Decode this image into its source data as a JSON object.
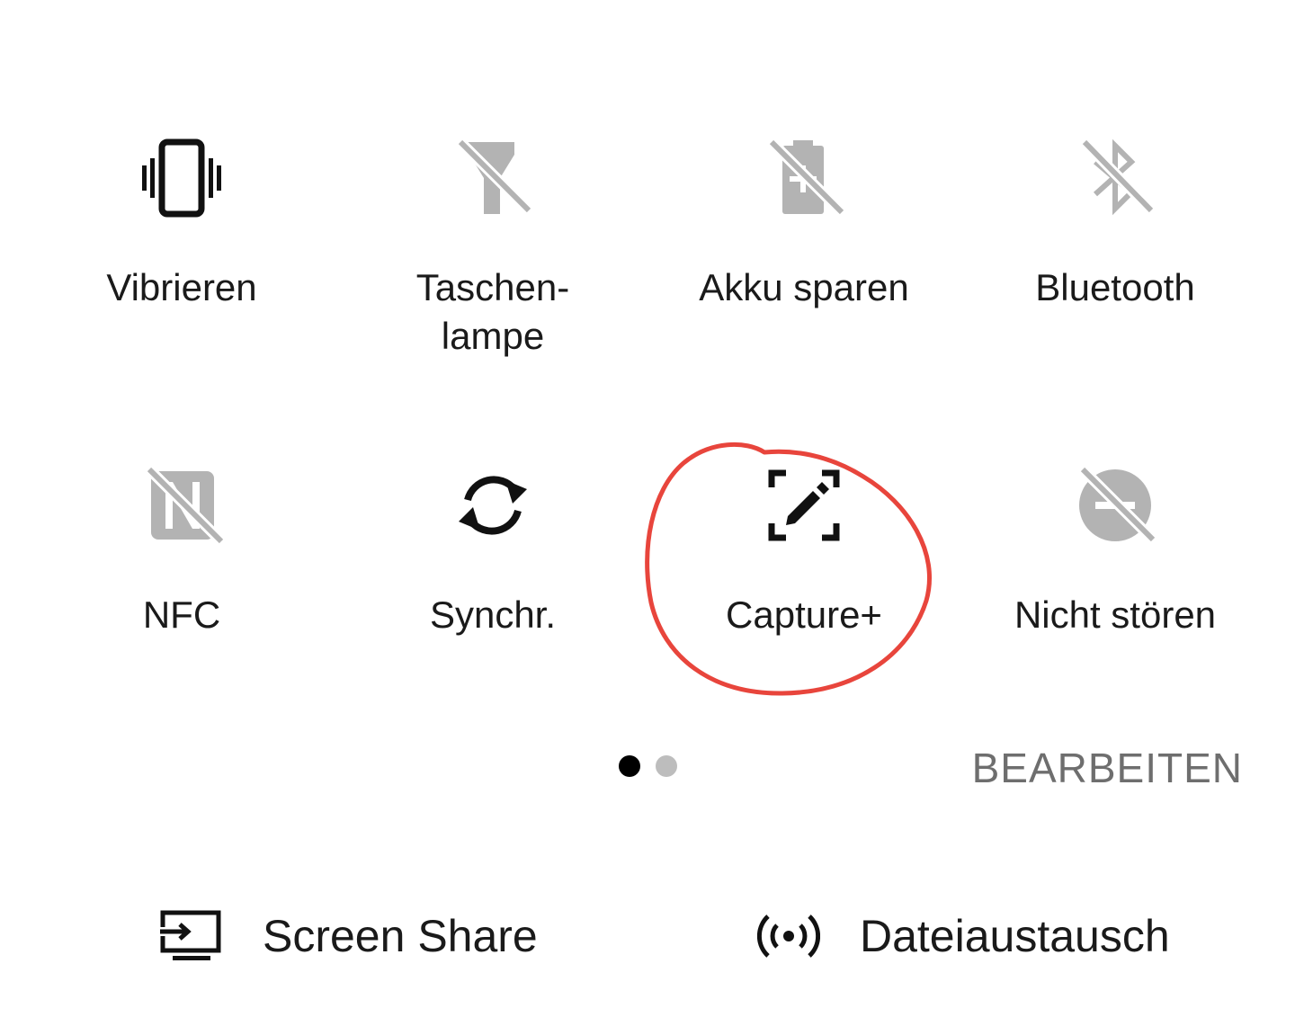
{
  "tiles": [
    {
      "label": "Vibrieren",
      "icon": "vibrate-icon",
      "state": "on"
    },
    {
      "label": "Taschen-\nlampe",
      "icon": "flashlight-off-icon",
      "state": "off"
    },
    {
      "label": "Akku sparen",
      "icon": "battery-saver-off-icon",
      "state": "off"
    },
    {
      "label": "Bluetooth",
      "icon": "bluetooth-off-icon",
      "state": "off"
    },
    {
      "label": "NFC",
      "icon": "nfc-off-icon",
      "state": "off"
    },
    {
      "label": "Synchr.",
      "icon": "sync-icon",
      "state": "on"
    },
    {
      "label": "Capture+",
      "icon": "capture-plus-icon",
      "state": "on"
    },
    {
      "label": "Nicht stören",
      "icon": "do-not-disturb-off-icon",
      "state": "off"
    }
  ],
  "pager": {
    "pages": 2,
    "current": 1
  },
  "edit_label": "BEARBEITEN",
  "shortcuts": [
    {
      "label": "Screen Share",
      "icon": "screen-share-icon"
    },
    {
      "label": "Dateiaustausch",
      "icon": "file-share-icon"
    }
  ],
  "colors": {
    "active": "#111111",
    "inactive": "#b3b3b3",
    "text": "#1a1a1a",
    "edit": "#6e6e6e",
    "annotation": "#e8453c",
    "dot_active": "#000000",
    "dot_inactive": "#bdbdbd"
  }
}
